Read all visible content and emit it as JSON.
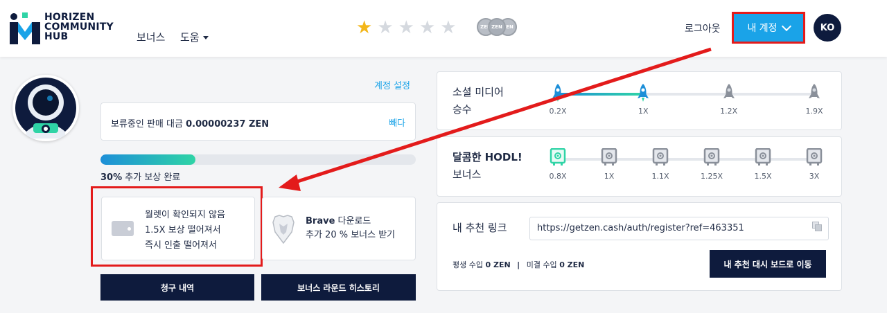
{
  "header": {
    "logo_lines": [
      "HORIZEN",
      "COMMUNITY",
      "HUB"
    ],
    "nav": {
      "bonus": "보너스",
      "help": "도움"
    },
    "rating": {
      "filled": 1,
      "total": 5
    },
    "zen_badges": [
      "ZEN",
      "ZEN",
      "ZEN"
    ],
    "logout": "로그아웃",
    "account_button": "내 계정",
    "language": "KO"
  },
  "left": {
    "account_settings": "계정 설정",
    "pending": {
      "label": "보류중인 판매 대금",
      "amount": "0.00000237 ZEN",
      "sell": "빼다"
    },
    "progress": {
      "percent": 30,
      "percent_text": "30%",
      "label": "추가 보상 완료"
    },
    "wallet": {
      "line1": "월렛이 확인되지 않음",
      "line2": "1.5X 보상 떨어져서",
      "line3": "즉시 인출 떨어져서"
    },
    "brave": {
      "title_bold": "Brave",
      "title_rest": " 다운로드",
      "subtitle": "추가 20 % 보너스 받기"
    },
    "claim_history": "청구 내역",
    "bonus_round_history": "보너스 라운드 히스토리"
  },
  "right": {
    "social": {
      "label_line1": "소셜 미디어",
      "label_line2": "승수",
      "levels": [
        "0.2X",
        "1X",
        "1.2X",
        "1.9X"
      ],
      "progress": 0.33
    },
    "hodl": {
      "label_bold": "달콤한 HODL!",
      "label_line2": "보너스",
      "levels": [
        "0.8X",
        "1X",
        "1.1X",
        "1.25X",
        "1.5X",
        "3X"
      ],
      "progress": 0
    },
    "referral": {
      "label": "내 추천 링크",
      "url": "https://getzen.cash/auth/register?ref=463351",
      "lifetime_label": "평생 수입",
      "lifetime_value": "0 ZEN",
      "unpaid_label": "미결 수입",
      "unpaid_value": "0 ZEN",
      "separator": "|",
      "dashboard_button": "내 추천 대시 보드로 이동"
    }
  },
  "colors": {
    "accent": "#1aa3e8",
    "navy": "#0e1b3d",
    "highlight_red": "#e31b1b",
    "star_gold": "#f3b61a"
  }
}
